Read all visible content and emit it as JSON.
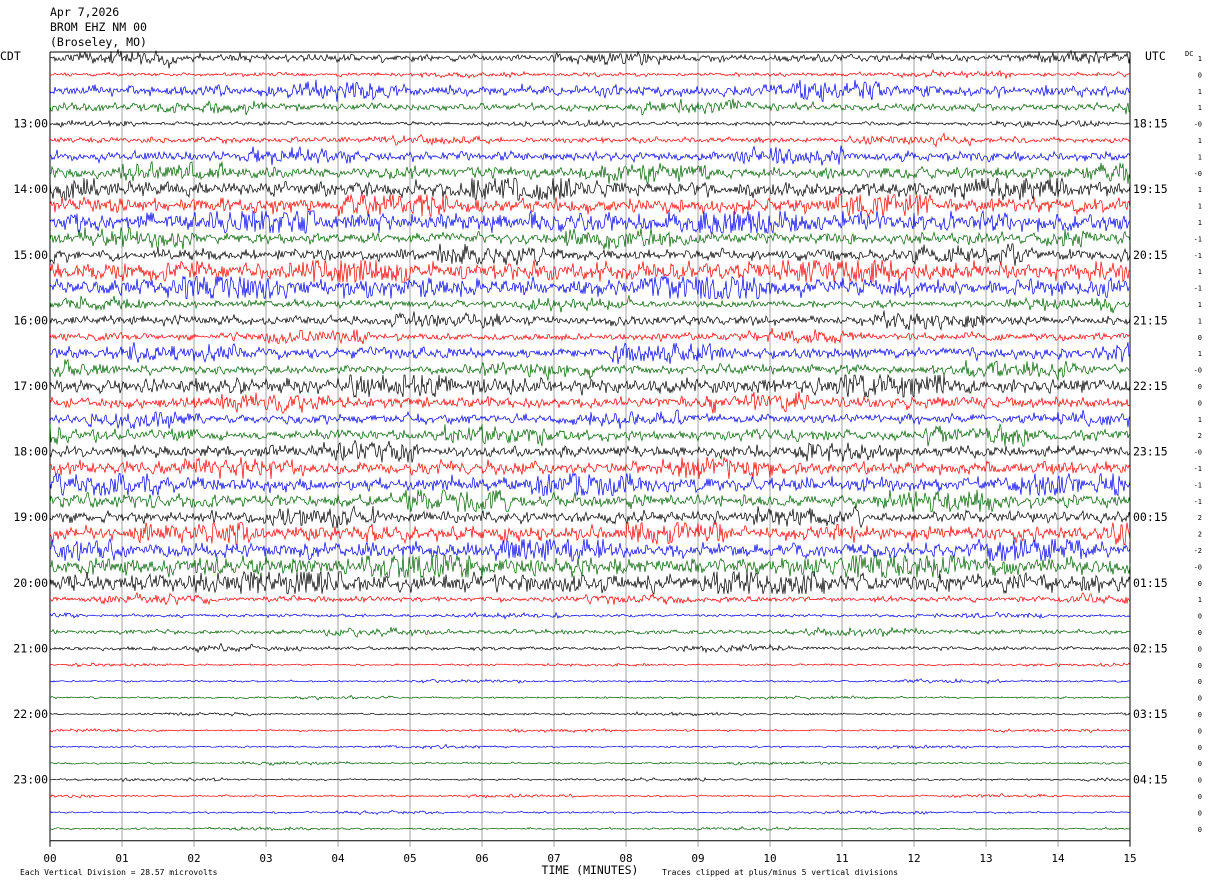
{
  "header": {
    "date": "Apr 7,2026",
    "station": "BROM EHZ NM 00",
    "location": "(Broseley, MO)"
  },
  "chart_data": {
    "type": "line",
    "title": "",
    "xlabel": "TIME (MINUTES)",
    "left_zone_label": "CDT",
    "right_zone_label": "UTC",
    "dc_label": "DC",
    "xlim": [
      0,
      15
    ],
    "x_tick_labels": [
      "00",
      "01",
      "02",
      "03",
      "04",
      "05",
      "06",
      "07",
      "08",
      "09",
      "10",
      "11",
      "12",
      "13",
      "14",
      "15"
    ],
    "grid": true,
    "rows_per_hour": 4,
    "row_minutes": 15,
    "trace_colors": [
      "#000000",
      "#ff0000",
      "#0000ff",
      "#006400"
    ],
    "left_hour_labels": [
      "13:00",
      "14:00",
      "15:00",
      "16:00",
      "17:00",
      "18:00",
      "19:00",
      "20:00",
      "21:00",
      "22:00",
      "23:00"
    ],
    "right_hour_labels": [
      "18:15",
      "19:15",
      "20:15",
      "21:15",
      "22:15",
      "23:15",
      "00:15",
      "01:15",
      "02:15",
      "03:15",
      "04:15"
    ],
    "dc_offsets": [
      "1",
      "0",
      "1",
      "1",
      "-0",
      "1",
      "1",
      "-0",
      "1",
      "1",
      "1",
      "-1",
      "-1",
      "1",
      "-1",
      "1",
      "1",
      "0",
      "1",
      "-0",
      "0",
      "0",
      "1",
      "2",
      "-0",
      "-1",
      "-1",
      "-1",
      "2",
      "2",
      "-2",
      "-0",
      "0",
      "1",
      "0",
      "0",
      "0",
      "0",
      "0",
      "0",
      "0",
      "0",
      "0",
      "0",
      "0",
      "0",
      "0",
      "0"
    ],
    "trace_amplitude_scale": [
      2,
      1,
      3,
      2,
      1,
      1.5,
      2.5,
      3,
      4,
      4,
      5,
      3,
      3,
      5,
      5,
      2,
      2.5,
      2,
      3,
      2.5,
      4,
      3,
      2.5,
      3,
      3,
      3.5,
      4,
      3.5,
      3,
      4,
      4,
      5,
      5,
      1.5,
      0.8,
      1.2,
      1,
      0.5,
      0.5,
      0.5,
      0.5,
      0.5,
      0.5,
      0.5,
      0.5,
      0.5,
      0.5,
      0.5
    ],
    "footer_left": "Each Vertical Division =   28.57 microvolts",
    "footer_right": "Traces clipped at plus/minus 5 vertical divisions"
  }
}
